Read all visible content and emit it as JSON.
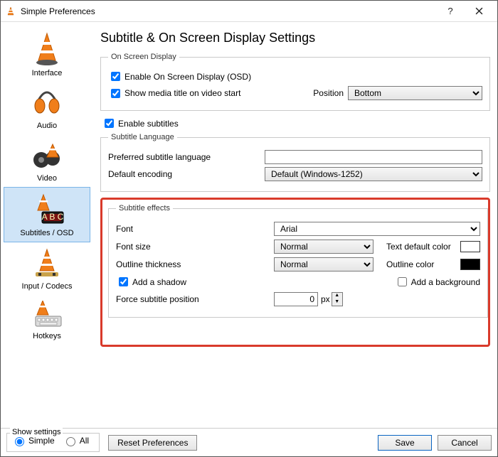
{
  "window": {
    "title": "Simple Preferences"
  },
  "sidebar": {
    "items": [
      {
        "label": "Interface"
      },
      {
        "label": "Audio"
      },
      {
        "label": "Video"
      },
      {
        "label": "Subtitles / OSD"
      },
      {
        "label": "Input / Codecs"
      },
      {
        "label": "Hotkeys"
      }
    ]
  },
  "page": {
    "title": "Subtitle & On Screen Display Settings",
    "osd": {
      "legend": "On Screen Display",
      "enable_osd": "Enable On Screen Display (OSD)",
      "show_media_title": "Show media title on video start",
      "position_label": "Position",
      "position_value": "Bottom"
    },
    "enable_subtitles": "Enable subtitles",
    "lang": {
      "legend": "Subtitle Language",
      "preferred_label": "Preferred subtitle language",
      "preferred_value": "",
      "encoding_label": "Default encoding",
      "encoding_value": "Default (Windows-1252)"
    },
    "effects": {
      "legend": "Subtitle effects",
      "font_label": "Font",
      "font_value": "Arial",
      "font_size_label": "Font size",
      "font_size_value": "Normal",
      "text_color_label": "Text default color",
      "text_color_value": "#ffffff",
      "outline_thickness_label": "Outline thickness",
      "outline_thickness_value": "Normal",
      "outline_color_label": "Outline color",
      "outline_color_value": "#000000",
      "add_shadow": "Add a shadow",
      "add_background": "Add a background",
      "force_pos_label": "Force subtitle position",
      "force_pos_value": "0",
      "force_pos_unit": "px"
    }
  },
  "footer": {
    "show_settings_label": "Show settings",
    "simple": "Simple",
    "all": "All",
    "reset": "Reset Preferences",
    "save": "Save",
    "cancel": "Cancel"
  }
}
